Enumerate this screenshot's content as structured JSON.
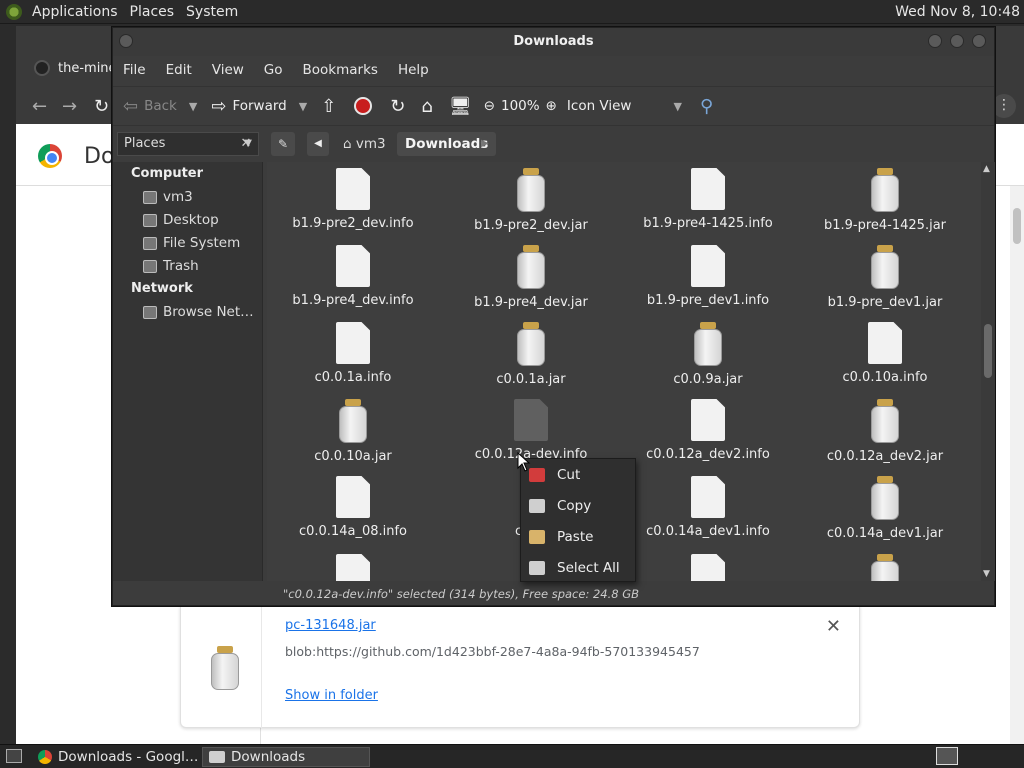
{
  "top_panel": {
    "menus": [
      "Applications",
      "Places",
      "System"
    ],
    "clock": "Wed Nov 8, 10:48"
  },
  "browser": {
    "tab_title": "the-mine",
    "page_title": "Do",
    "download": {
      "filename": "pc-131648.jar",
      "url": "blob:https://github.com/1d423bbf-28e7-4a8a-94fb-570133945457",
      "show_in_folder": "Show in folder"
    }
  },
  "file_manager": {
    "title": "Downloads",
    "menu": [
      "File",
      "Edit",
      "View",
      "Go",
      "Bookmarks",
      "Help"
    ],
    "toolbar": {
      "back": "Back",
      "forward": "Forward",
      "zoom": "100%",
      "view_mode": "Icon View"
    },
    "places_label": "Places",
    "breadcrumb": [
      "vm3",
      "Downloads"
    ],
    "sidebar": {
      "computer_label": "Computer",
      "computer_items": [
        {
          "label": "vm3",
          "icon": "home-folder-icon"
        },
        {
          "label": "Desktop",
          "icon": "desktop-folder-icon"
        },
        {
          "label": "File System",
          "icon": "drive-icon"
        },
        {
          "label": "Trash",
          "icon": "trash-icon"
        }
      ],
      "network_label": "Network",
      "network_items": [
        {
          "label": "Browse Net…",
          "icon": "network-icon"
        }
      ]
    },
    "files": [
      {
        "name": "b1.9-pre2_dev.info",
        "type": "doc"
      },
      {
        "name": "b1.9-pre2_dev.jar",
        "type": "jar"
      },
      {
        "name": "b1.9-pre4-1425.info",
        "type": "doc"
      },
      {
        "name": "b1.9-pre4-1425.jar",
        "type": "jar"
      },
      {
        "name": "b1.9-pre4_dev.info",
        "type": "doc"
      },
      {
        "name": "b1.9-pre4_dev.jar",
        "type": "jar"
      },
      {
        "name": "b1.9-pre_dev1.info",
        "type": "doc"
      },
      {
        "name": "b1.9-pre_dev1.jar",
        "type": "jar"
      },
      {
        "name": "c0.0.1a.info",
        "type": "doc"
      },
      {
        "name": "c0.0.1a.jar",
        "type": "jar"
      },
      {
        "name": "c0.0.9a.jar",
        "type": "jar"
      },
      {
        "name": "c0.0.10a.info",
        "type": "doc"
      },
      {
        "name": "c0.0.10a.jar",
        "type": "jar"
      },
      {
        "name": "c0.0.12a-dev.info",
        "type": "doc",
        "selected": true
      },
      {
        "name": "c0.0.12a_dev2.info",
        "type": "doc"
      },
      {
        "name": "c0.0.12a_dev2.jar",
        "type": "jar"
      },
      {
        "name": "c0.0.14a_08.info",
        "type": "doc"
      },
      {
        "name": "c0.0.",
        "type": "none"
      },
      {
        "name": "c0.0.14a_dev1.info",
        "type": "doc"
      },
      {
        "name": "c0.0.14a_dev1.jar",
        "type": "jar"
      }
    ],
    "status": "\"c0.0.12a-dev.info\" selected (314 bytes), Free space: 24.8 GB"
  },
  "context_menu": {
    "items": [
      {
        "label": "Cut",
        "icon": "scissors-icon",
        "color": "#d23c3c"
      },
      {
        "label": "Copy",
        "icon": "copy-icon",
        "color": "#cfcfcf"
      },
      {
        "label": "Paste",
        "icon": "paste-icon",
        "color": "#d8b36a"
      },
      {
        "label": "Select All",
        "icon": "select-all-icon",
        "color": "#cfcfcf"
      }
    ]
  },
  "taskbar": {
    "tasks": [
      "Downloads - Googl…",
      "Downloads"
    ]
  }
}
